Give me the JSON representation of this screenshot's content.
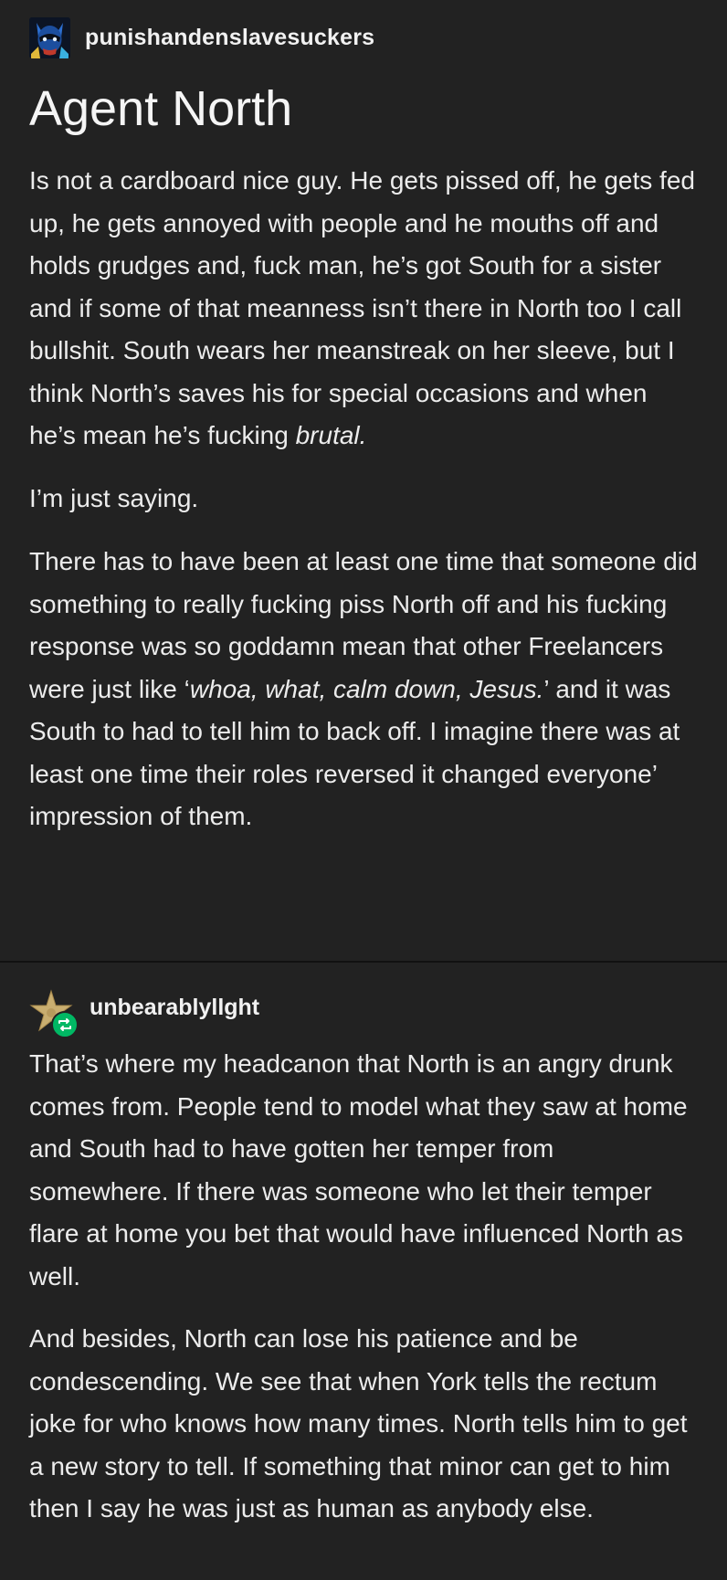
{
  "post": {
    "username": "punishandenslavesuckers",
    "title": "Agent North",
    "paragraphs": [
      {
        "before": "Is not a cardboard nice guy. He gets pissed off, he gets fed up, he gets annoyed with people and he mouths off and holds grudges and, fuck man, he’s got South for a sister and if some of that meanness isn’t there in North too I call bullshit. South wears her meanstreak on her sleeve, but I think North’s saves his for special occasions and when he’s mean he’s fucking ",
        "italic": "brutal.",
        "after": ""
      },
      {
        "before": "I’m just saying.",
        "italic": "",
        "after": ""
      },
      {
        "before": "There has to have been at least one time that someone did something to really fucking piss North off and his fucking response was so goddamn mean that other Freelancers were just like ‘",
        "italic": "whoa, what, calm down, Jesus.",
        "after": "’ and it was South to had to tell him to back off. I imagine there was at least one time their roles reversed it changed everyone’ impression of them."
      }
    ]
  },
  "reblog": {
    "username": "unbearablyllght",
    "paragraphs": [
      "That’s where my headcanon that North is an angry drunk comes from. People tend to model what they saw at home and South had to have gotten her temper from somewhere. If there was someone who let their temper flare at home you bet that would have influenced North as well.",
      "And besides, North can lose his patience and be condescending. We see that when York tells the rectum joke for who knows how many times. North tells him to get a new story to tell. If something that minor can get to him then I say he was just as human as anybody else."
    ]
  },
  "colors": {
    "background": "#222222",
    "text": "#ececec",
    "reblog_badge": "#00b864",
    "divider": "#111111"
  },
  "icons": {
    "op_avatar": "blue-masked-character-avatar",
    "reblog_avatar": "gold-star-avatar",
    "reblog_badge": "reblog-icon"
  }
}
